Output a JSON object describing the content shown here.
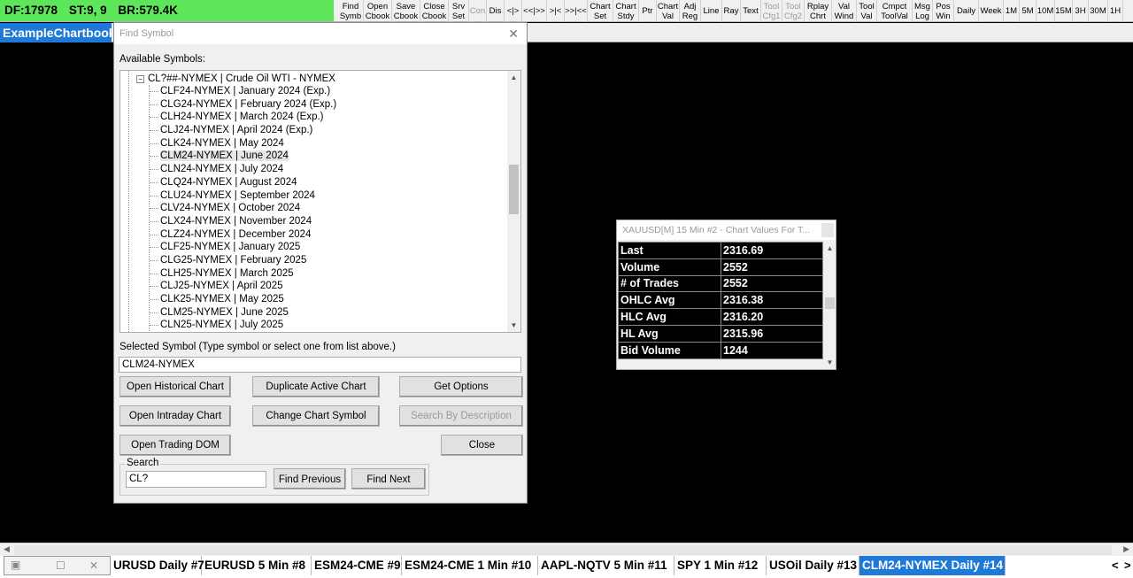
{
  "status": {
    "df": "DF:17978",
    "st": "ST:9, 9",
    "br": "BR:579.4K"
  },
  "toolbar": [
    {
      "l1": "Find",
      "l2": "Symb"
    },
    {
      "l1": "Open",
      "l2": "Cbook"
    },
    {
      "l1": "Save",
      "l2": "Cbook"
    },
    {
      "l1": "Close",
      "l2": "Cbook"
    },
    {
      "l1": "Srv",
      "l2": "Set"
    },
    {
      "l1": "Con",
      "l2": ""
    },
    {
      "l1": "Dis",
      "l2": ""
    },
    {
      "l1": "<|>",
      "l2": ""
    },
    {
      "l1": "<<|>>",
      "l2": ""
    },
    {
      "l1": ">|<",
      "l2": ""
    },
    {
      "l1": ">>|<<",
      "l2": ""
    },
    {
      "l1": "Chart",
      "l2": "Set"
    },
    {
      "l1": "Chart",
      "l2": "Stdy"
    },
    {
      "l1": "Ptr",
      "l2": ""
    },
    {
      "l1": "Chart",
      "l2": "Val"
    },
    {
      "l1": "Adj",
      "l2": "Reg"
    },
    {
      "l1": "Line",
      "l2": ""
    },
    {
      "l1": "Ray",
      "l2": ""
    },
    {
      "l1": "Text",
      "l2": ""
    },
    {
      "l1": "Tool",
      "l2": "Cfg1"
    },
    {
      "l1": "Tool",
      "l2": "Cfg2"
    },
    {
      "l1": "Rplay",
      "l2": "Chrt"
    },
    {
      "l1": "Val",
      "l2": "Wind"
    },
    {
      "l1": "Tool",
      "l2": "Val"
    },
    {
      "l1": "Cmpct",
      "l2": "ToolVal"
    },
    {
      "l1": "Msg",
      "l2": "Log"
    },
    {
      "l1": "Pos",
      "l2": "Win"
    },
    {
      "l1": "Daily",
      "l2": ""
    },
    {
      "l1": "Week",
      "l2": ""
    },
    {
      "l1": "1M",
      "l2": ""
    },
    {
      "l1": "5M",
      "l2": ""
    },
    {
      "l1": "10M",
      "l2": ""
    },
    {
      "l1": "15M",
      "l2": ""
    },
    {
      "l1": "3H",
      "l2": ""
    },
    {
      "l1": "30M",
      "l2": ""
    },
    {
      "l1": "1H",
      "l2": ""
    }
  ],
  "chartbook": {
    "name": "ExampleChartbook"
  },
  "find_symbol": {
    "title": "Find Symbol",
    "available_label": "Available Symbols:",
    "root": "CL?##-NYMEX  |  Crude Oil WTI - NYMEX",
    "items": [
      "CLF24-NYMEX  |  January 2024 (Exp.)",
      "CLG24-NYMEX  |  February 2024 (Exp.)",
      "CLH24-NYMEX  |  March 2024 (Exp.)",
      "CLJ24-NYMEX  |  April 2024 (Exp.)",
      "CLK24-NYMEX  |  May 2024",
      "CLM24-NYMEX  |  June 2024",
      "CLN24-NYMEX  |  July 2024",
      "CLQ24-NYMEX  |  August 2024",
      "CLU24-NYMEX  |  September 2024",
      "CLV24-NYMEX  |  October 2024",
      "CLX24-NYMEX  |  November 2024",
      "CLZ24-NYMEX  |  December 2024",
      "CLF25-NYMEX  |  January 2025",
      "CLG25-NYMEX  |  February 2025",
      "CLH25-NYMEX  |  March 2025",
      "CLJ25-NYMEX  |  April 2025",
      "CLK25-NYMEX  |  May 2025",
      "CLM25-NYMEX  |  June 2025",
      "CLN25-NYMEX  |  July 2025"
    ],
    "selected_index": 5,
    "selected_label": "Selected Symbol (Type symbol or select one from list above.)",
    "selected_value": "CLM24-NYMEX",
    "buttons": {
      "open_historical": "Open Historical Chart",
      "duplicate": "Duplicate Active Chart",
      "get_options": "Get Options",
      "open_intraday": "Open Intraday Chart",
      "change_symbol": "Change Chart Symbol",
      "search_desc": "Search By Description",
      "open_dom": "Open Trading DOM",
      "close": "Close",
      "find_prev": "Find Previous",
      "find_next": "Find Next"
    },
    "search_label": "Search",
    "search_value": "CL?"
  },
  "chart_values": {
    "title": "XAUUSD[M]  15 Min  #2 - Chart Values For T...",
    "rows": [
      {
        "k": "Last",
        "v": "2316.69"
      },
      {
        "k": "Volume",
        "v": "2552"
      },
      {
        "k": "# of Trades",
        "v": "2552"
      },
      {
        "k": "OHLC Avg",
        "v": "2316.38"
      },
      {
        "k": "HLC Avg",
        "v": "2316.20"
      },
      {
        "k": "HL Avg",
        "v": "2315.96"
      },
      {
        "k": "Bid Volume",
        "v": "1244"
      }
    ]
  },
  "tabs": [
    "URUSD  Daily #7",
    "EURUSD  5 Min  #8",
    "ESM24-CME #9",
    "ESM24-CME  1 Min  #10",
    "AAPL-NQTV  5 Min  #11",
    "SPY  1 Min  #12",
    "USOil  Daily #13",
    "CLM24-NYMEX  Daily #14"
  ],
  "tab_nav": {
    "prev": "<",
    "next": ">"
  }
}
